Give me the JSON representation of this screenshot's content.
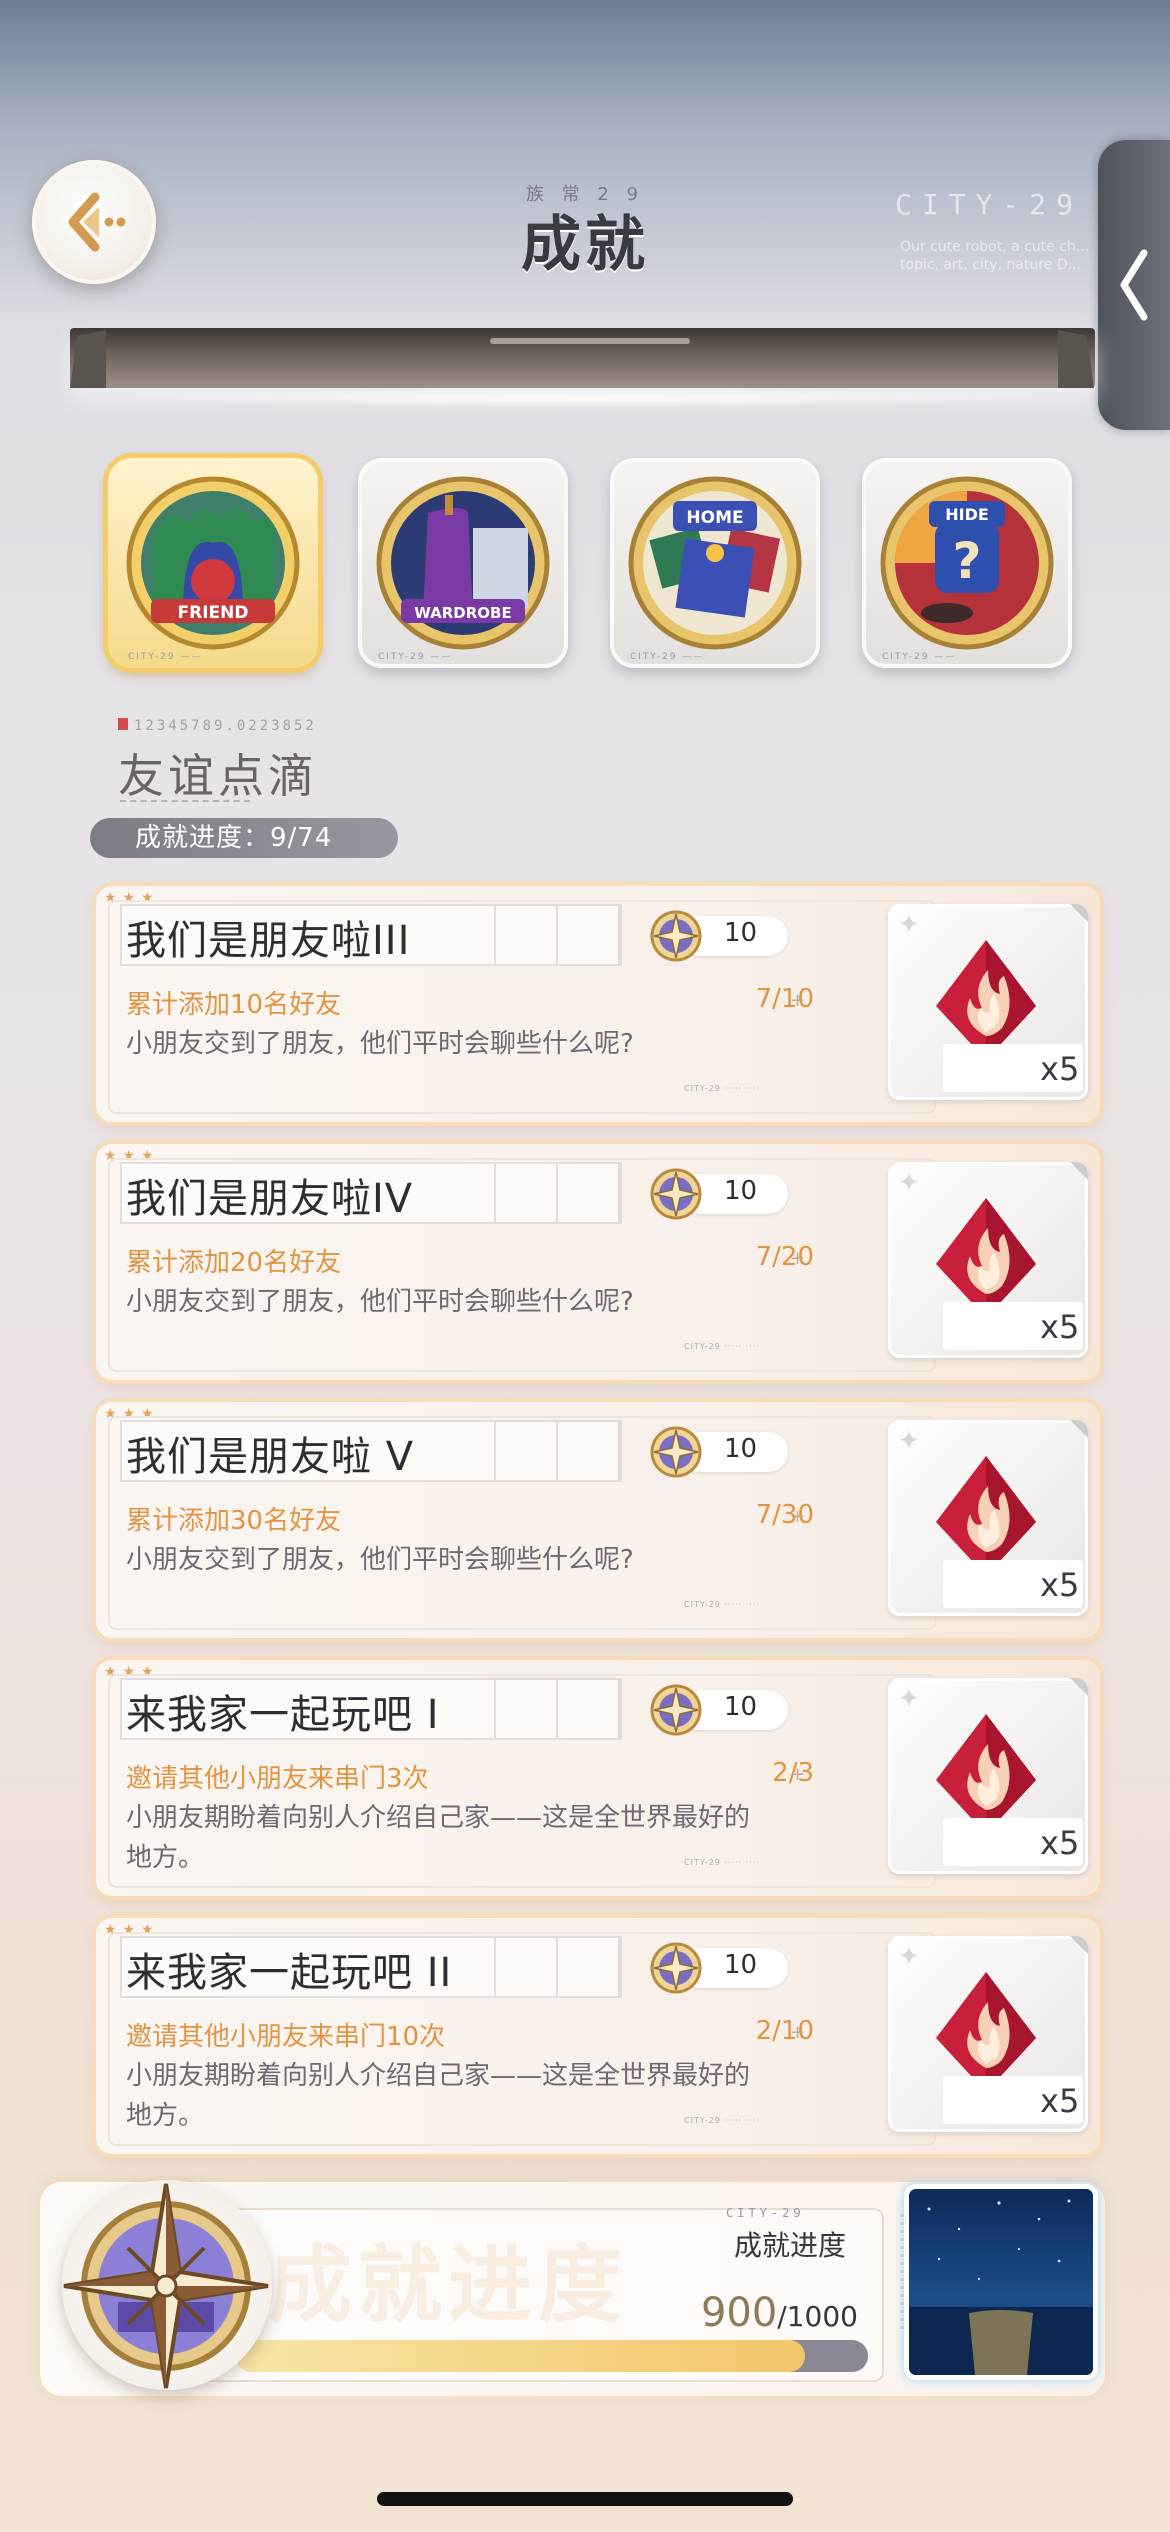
{
  "header": {
    "title": "成就",
    "subtitle": "族 常 2 9",
    "brand": "CITY-29",
    "brand_sub": "Our cute robot, a cute ch... topic, art, city, nature D..."
  },
  "categories": [
    {
      "label": "FRIEND",
      "active": true,
      "accent": "#e9b93f"
    },
    {
      "label": "WARDROBE",
      "active": false,
      "accent": "#7a3aa5"
    },
    {
      "label": "HOME",
      "active": false,
      "accent": "#3b4fb5"
    },
    {
      "label": "HIDE",
      "active": false,
      "accent": "#b5323a"
    }
  ],
  "category_footer": "CITY-29 ——",
  "section": {
    "code": "12345789.0223852",
    "title": "友谊点滴",
    "progress_text": "成就进度：9/74"
  },
  "achievements": [
    {
      "name": "我们是朋友啦III",
      "points": "10",
      "requirement": "累计添加10名好友",
      "count": "7/10",
      "description": "小朋友交到了朋友，他们平时会聊些什么呢?",
      "reward_qty": "x5"
    },
    {
      "name": "我们是朋友啦IV",
      "points": "10",
      "requirement": "累计添加20名好友",
      "count": "7/20",
      "description": "小朋友交到了朋友，他们平时会聊些什么呢?",
      "reward_qty": "x5"
    },
    {
      "name": "我们是朋友啦 V",
      "points": "10",
      "requirement": "累计添加30名好友",
      "count": "7/30",
      "description": "小朋友交到了朋友，他们平时会聊些什么呢?",
      "reward_qty": "x5"
    },
    {
      "name": "来我家一起玩吧 I",
      "points": "10",
      "requirement": "邀请其他小朋友来串门3次",
      "count": "2/3",
      "description": "小朋友期盼着向别人介绍自己家——这是全世界最好的地方。",
      "reward_qty": "x5"
    },
    {
      "name": "来我家一起玩吧 II",
      "points": "10",
      "requirement": "邀请其他小朋友来串门10次",
      "count": "2/10",
      "description": "小朋友期盼着向别人介绍自己家——这是全世界最好的地方。",
      "reward_qty": "x5"
    }
  ],
  "bottom": {
    "watermark": "成就进度",
    "label": "成就进度",
    "city": "CITY-29",
    "current": "900",
    "total": "/1000",
    "progress": 0.9
  },
  "colors": {
    "accent_orange": "#e19443",
    "progress_fill": "#f2c76a",
    "card_border": "#f6dcb8"
  },
  "icons": [
    "back-arrow-icon",
    "chevron-left-icon",
    "compass-medal-icon",
    "fire-gem-icon"
  ]
}
